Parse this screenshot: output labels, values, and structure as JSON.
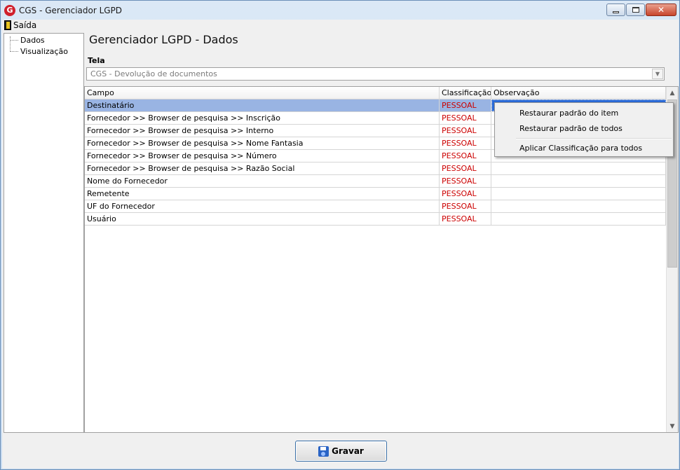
{
  "window": {
    "title": "CGS - Gerenciador LGPD",
    "logo_letter": "G"
  },
  "menu": {
    "exit_label": "Saída"
  },
  "tree": {
    "items": [
      "Dados",
      "Visualização"
    ]
  },
  "page": {
    "title": "Gerenciador LGPD - Dados"
  },
  "tela": {
    "label": "Tela",
    "value": "CGS - Devolução de documentos"
  },
  "grid": {
    "headers": [
      "Campo",
      "Classificação",
      "Observação"
    ],
    "rows": [
      {
        "campo": "Destinatário",
        "classificacao": "PESSOAL",
        "observacao": ""
      },
      {
        "campo": "Fornecedor >> Browser de pesquisa >> Inscrição",
        "classificacao": "PESSOAL",
        "observacao": ""
      },
      {
        "campo": "Fornecedor >> Browser de pesquisa >> Interno",
        "classificacao": "PESSOAL",
        "observacao": ""
      },
      {
        "campo": "Fornecedor >> Browser de pesquisa >> Nome Fantasia",
        "classificacao": "PESSOAL",
        "observacao": ""
      },
      {
        "campo": "Fornecedor >> Browser de pesquisa >> Número",
        "classificacao": "PESSOAL",
        "observacao": ""
      },
      {
        "campo": "Fornecedor >> Browser de pesquisa >> Razão Social",
        "classificacao": "PESSOAL",
        "observacao": ""
      },
      {
        "campo": "Nome do Fornecedor",
        "classificacao": "PESSOAL",
        "observacao": ""
      },
      {
        "campo": "Remetente",
        "classificacao": "PESSOAL",
        "observacao": ""
      },
      {
        "campo": "UF do Fornecedor",
        "classificacao": "PESSOAL",
        "observacao": ""
      },
      {
        "campo": "Usuário",
        "classificacao": "PESSOAL",
        "observacao": ""
      }
    ]
  },
  "context_menu": {
    "items": [
      "Restaurar padrão do item",
      "Restaurar padrão de todos",
      "Aplicar Classificação para todos"
    ]
  },
  "save_button": {
    "label": "Gravar"
  },
  "colors": {
    "classification": "#cc0000",
    "selected_row": "#99b4e3",
    "selected_cell": "#2b6ad6"
  }
}
